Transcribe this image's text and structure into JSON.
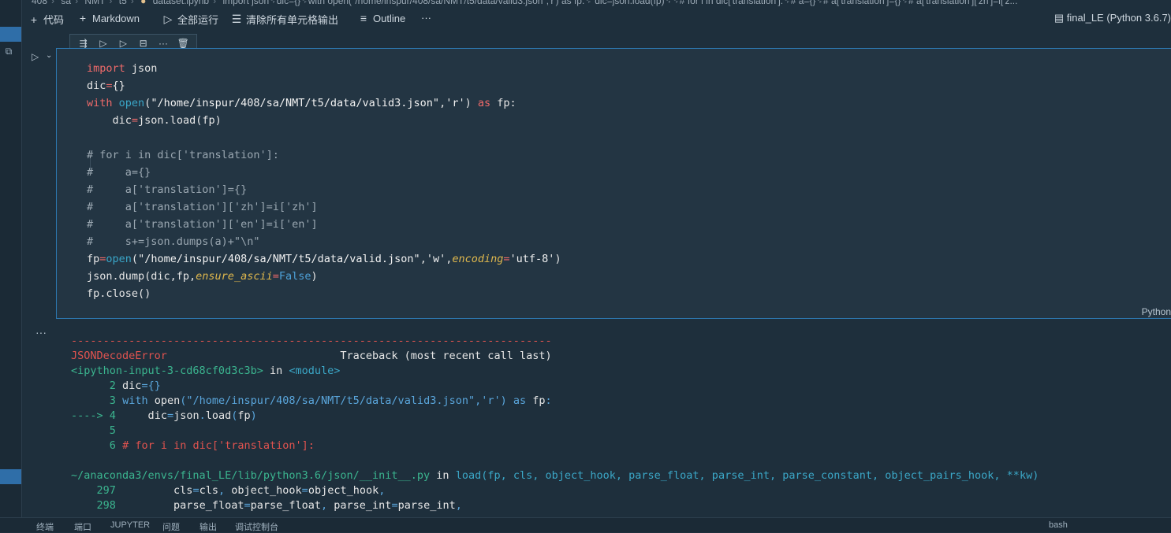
{
  "breadcrumb": [
    "408",
    "sa",
    "NMT",
    "t5",
    "dataset.ipynb",
    "import json␊dic={}␊with open(\"/home/inspur/408/sa/NMT/t5/data/valid3.json\",'r') as fp:␊    dic=json.load(fp)␊␊# for i in dic['translation']:␊#     a={}␊#     a['translation']={}␊#     a['translation']['zh']=i['z..."
  ],
  "toolbar": {
    "code_label": "代码",
    "markdown_label": "Markdown",
    "run_all_label": "全部运行",
    "clear_outputs_label": "清除所有单元格输出",
    "outline_label": "Outline",
    "more_label": "···"
  },
  "kernel": {
    "label": "final_LE (Python 3.6.7)"
  },
  "cell_toolbar": {
    "more_label": "···"
  },
  "cell": {
    "language": "Python",
    "code_lines": [
      "import json",
      "dic={}",
      "with open(\"/home/inspur/408/sa/NMT/t5/data/valid3.json\",'r') as fp:",
      "    dic=json.load(fp)",
      "",
      "# for i in dic['translation']:",
      "#     a={}",
      "#     a['translation']={}",
      "#     a['translation']['zh']=i['zh']",
      "#     a['translation']['en']=i['en']",
      "#     s+=json.dumps(a)+\"\\n\"",
      "fp=open(\"/home/inspur/408/sa/NMT/t5/data/valid.json\",'w',encoding='utf-8')",
      "json.dump(dic,fp,ensure_ascii=False)",
      "fp.close()"
    ]
  },
  "output": {
    "more_label": "···",
    "separator": "---------------------------------------------------------------------------",
    "error_name": "JSONDecodeError",
    "traceback_header": "Traceback (most recent call last)",
    "input_ref": "<ipython-input-3-cd68cf0d3c3b>",
    "in_word": "in",
    "module_ref": "<module>",
    "arrow": "---->",
    "frame1": [
      {
        "num": "2",
        "text": "dic={}"
      },
      {
        "num": "3",
        "text": "with open(\"/home/inspur/408/sa/NMT/t5/data/valid3.json\",'r') as fp:"
      },
      {
        "num": "4",
        "text": "    dic=json.load(fp)"
      },
      {
        "num": "5",
        "text": ""
      },
      {
        "num": "6",
        "text": "# for i in dic['translation']:"
      }
    ],
    "file2": "~/anaconda3/envs/final_LE/lib/python3.6/json/__init__.py",
    "func2": "load(fp, cls, object_hook, parse_float, parse_int, parse_constant, object_pairs_hook, **kw)",
    "frame2": [
      {
        "num": "297",
        "text": "        cls=cls, object_hook=object_hook,"
      },
      {
        "num": "298",
        "text": "        parse_float=parse_float, parse_int=parse_int,"
      }
    ]
  },
  "statusbar": {
    "items": [
      "终端",
      "端口",
      "JUPYTER",
      "问题",
      "输出",
      "调试控制台"
    ],
    "right": "bash"
  },
  "colors": {
    "accent": "#2d78b0",
    "background": "#1e2f3c",
    "editor_bg": "#233543",
    "keyword": "#ef6a6a",
    "builtin": "#3aa6c8",
    "error": "#e0534f",
    "lineno": "#3bb58f"
  }
}
